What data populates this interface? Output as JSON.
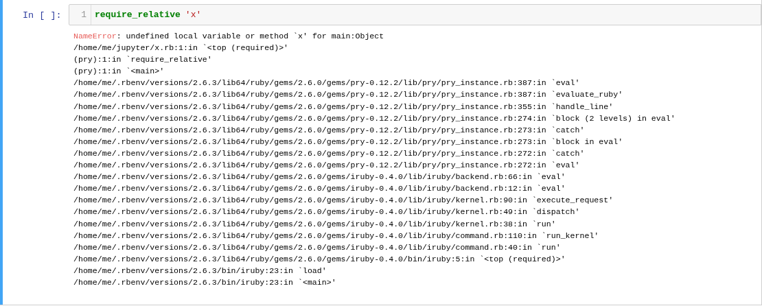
{
  "cell": {
    "selected": true,
    "prompt": "In [ ]:",
    "line_number": "1",
    "code": [
      {
        "text": "require_relative",
        "kind": "builtin"
      },
      {
        "text": "'x'",
        "kind": "string"
      }
    ],
    "output": {
      "error_name": "NameError",
      "error_message": ": undefined local variable or method `x' for main:Object",
      "traceback": [
        "/home/me/jupyter/x.rb:1:in `<top (required)>'",
        "(pry):1:in `require_relative'",
        "(pry):1:in `<main>'",
        "/home/me/.rbenv/versions/2.6.3/lib64/ruby/gems/2.6.0/gems/pry-0.12.2/lib/pry/pry_instance.rb:387:in `eval'",
        "/home/me/.rbenv/versions/2.6.3/lib64/ruby/gems/2.6.0/gems/pry-0.12.2/lib/pry/pry_instance.rb:387:in `evaluate_ruby'",
        "/home/me/.rbenv/versions/2.6.3/lib64/ruby/gems/2.6.0/gems/pry-0.12.2/lib/pry/pry_instance.rb:355:in `handle_line'",
        "/home/me/.rbenv/versions/2.6.3/lib64/ruby/gems/2.6.0/gems/pry-0.12.2/lib/pry/pry_instance.rb:274:in `block (2 levels) in eval'",
        "/home/me/.rbenv/versions/2.6.3/lib64/ruby/gems/2.6.0/gems/pry-0.12.2/lib/pry/pry_instance.rb:273:in `catch'",
        "/home/me/.rbenv/versions/2.6.3/lib64/ruby/gems/2.6.0/gems/pry-0.12.2/lib/pry/pry_instance.rb:273:in `block in eval'",
        "/home/me/.rbenv/versions/2.6.3/lib64/ruby/gems/2.6.0/gems/pry-0.12.2/lib/pry/pry_instance.rb:272:in `catch'",
        "/home/me/.rbenv/versions/2.6.3/lib64/ruby/gems/2.6.0/gems/pry-0.12.2/lib/pry/pry_instance.rb:272:in `eval'",
        "/home/me/.rbenv/versions/2.6.3/lib64/ruby/gems/2.6.0/gems/iruby-0.4.0/lib/iruby/backend.rb:66:in `eval'",
        "/home/me/.rbenv/versions/2.6.3/lib64/ruby/gems/2.6.0/gems/iruby-0.4.0/lib/iruby/backend.rb:12:in `eval'",
        "/home/me/.rbenv/versions/2.6.3/lib64/ruby/gems/2.6.0/gems/iruby-0.4.0/lib/iruby/kernel.rb:90:in `execute_request'",
        "/home/me/.rbenv/versions/2.6.3/lib64/ruby/gems/2.6.0/gems/iruby-0.4.0/lib/iruby/kernel.rb:49:in `dispatch'",
        "/home/me/.rbenv/versions/2.6.3/lib64/ruby/gems/2.6.0/gems/iruby-0.4.0/lib/iruby/kernel.rb:38:in `run'",
        "/home/me/.rbenv/versions/2.6.3/lib64/ruby/gems/2.6.0/gems/iruby-0.4.0/lib/iruby/command.rb:110:in `run_kernel'",
        "/home/me/.rbenv/versions/2.6.3/lib64/ruby/gems/2.6.0/gems/iruby-0.4.0/lib/iruby/command.rb:40:in `run'",
        "/home/me/.rbenv/versions/2.6.3/lib64/ruby/gems/2.6.0/gems/iruby-0.4.0/bin/iruby:5:in `<top (required)>'",
        "/home/me/.rbenv/versions/2.6.3/bin/iruby:23:in `load'",
        "/home/me/.rbenv/versions/2.6.3/bin/iruby:23:in `<main>'"
      ]
    }
  }
}
